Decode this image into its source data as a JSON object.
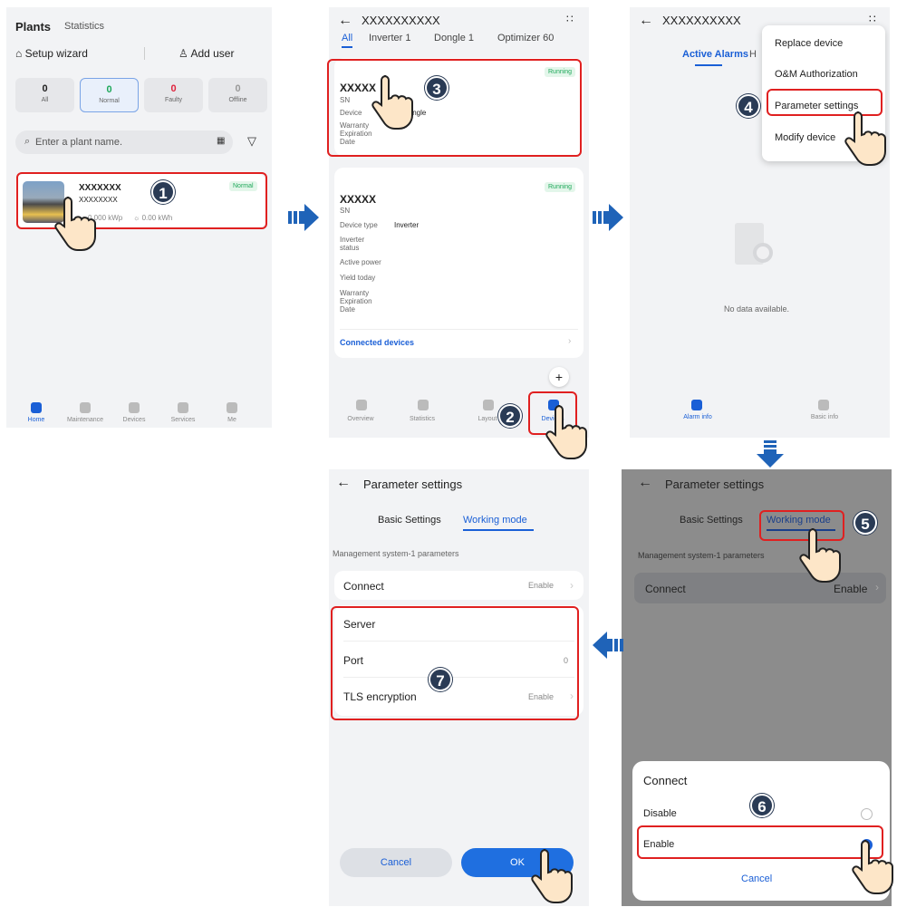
{
  "s1": {
    "title": "Plants",
    "title2": "Statistics",
    "setup": "Setup wizard",
    "adduser": "Add user",
    "stats": [
      {
        "n": "0",
        "l": "All",
        "c": "#222"
      },
      {
        "n": "0",
        "l": "Normal",
        "c": "#1ea85a"
      },
      {
        "n": "0",
        "l": "Faulty",
        "c": "#e0243e"
      },
      {
        "n": "0",
        "l": "Offline",
        "c": "#999"
      }
    ],
    "search_ph": "Enter a plant name.",
    "plant_name": "XXXXXXX",
    "plant_sub": "XXXXXXXX",
    "plant_kwp": "0.000 kWp",
    "plant_kwh": "0.00 kWh",
    "plant_status": "Normal",
    "tabs": [
      "Home",
      "Maintenance",
      "Devices",
      "Services",
      "Me"
    ]
  },
  "s2": {
    "title": "XXXXXXXXXX",
    "tabs": [
      "All",
      "Inverter 1",
      "Dongle 1",
      "Optimizer 60"
    ],
    "c1_name": "XXXXX",
    "c1_sn": "SN",
    "c1_dt": "Device",
    "c1_dtv": "Dongle",
    "c1_w": "Warranty Expiration Date",
    "c1_status": "Running",
    "c2_name": "XXXXX",
    "c2_sn": "SN",
    "c2_dt": "Device type",
    "c2_dtv": "Inverter",
    "c2_is": "Inverter status",
    "c2_ap": "Active power",
    "c2_yt": "Yield today",
    "c2_w": "Warranty Expiration Date",
    "c2_status": "Running",
    "connected": "Connected devices",
    "plus": "+",
    "tabs_b": [
      "Overview",
      "Statistics",
      "Layout",
      "Devices"
    ]
  },
  "s3": {
    "title": "XXXXXXXXXX",
    "tab1": "Active Alarms",
    "tab2": "H",
    "menu": [
      "Replace device",
      "O&M Authorization",
      "Parameter settings",
      "Modify device"
    ],
    "nodata": "No data available.",
    "tabs_b": [
      "Alarm info",
      "Basic info"
    ]
  },
  "s4": {
    "title": "Parameter settings",
    "tab1": "Basic Settings",
    "tab2": "Working mode",
    "section": "Management system-1 parameters",
    "rows": [
      {
        "l": "Connect",
        "v": "Enable"
      },
      {
        "l": "Server",
        "v": ""
      },
      {
        "l": "Port",
        "v": "0"
      },
      {
        "l": "TLS encryption",
        "v": "Enable"
      }
    ],
    "cancel": "Cancel",
    "ok": "OK"
  },
  "s5": {
    "title": "Parameter settings",
    "tab1": "Basic Settings",
    "tab2": "Working mode",
    "section": "Management system-1 parameters",
    "connect": "Connect",
    "connect_v": "Enable",
    "dlg_title": "Connect",
    "opt1": "Disable",
    "opt2": "Enable",
    "cancel": "Cancel"
  },
  "steps": [
    "1",
    "2",
    "3",
    "4",
    "5",
    "6",
    "7"
  ]
}
